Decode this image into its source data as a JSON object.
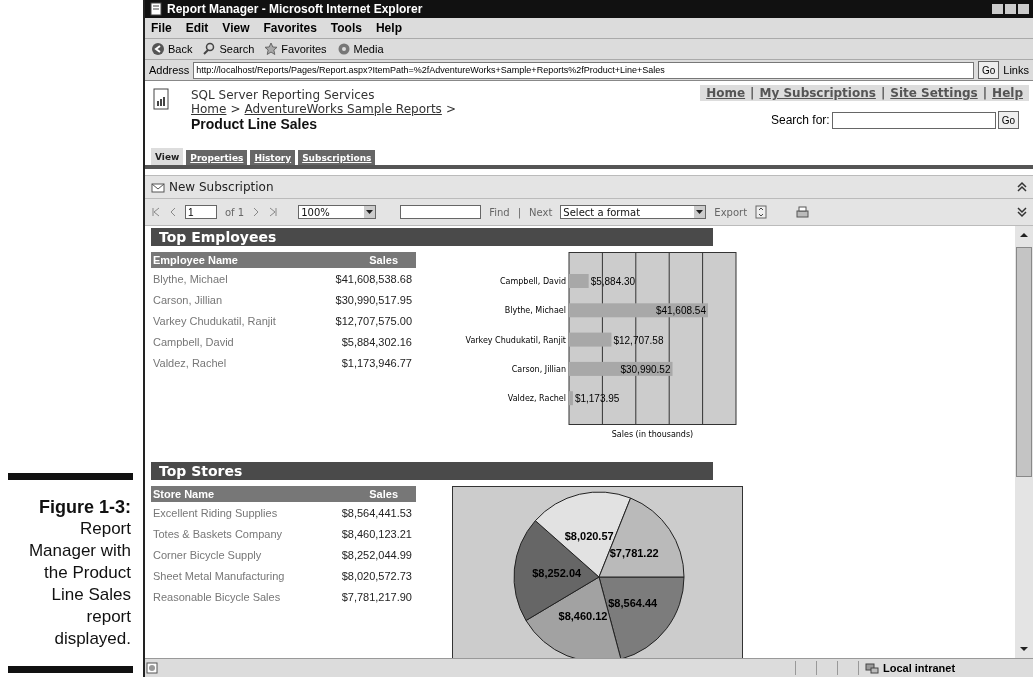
{
  "caption": {
    "label": "Figure 1-3:",
    "text": "Report Manager with the Product Line Sales report displayed."
  },
  "window": {
    "title": "Report Manager - Microsoft Internet Explorer"
  },
  "menu_bar": [
    "File",
    "Edit",
    "View",
    "Favorites",
    "Tools",
    "Help"
  ],
  "toolbar": [
    {
      "label": "Back",
      "kind": "back"
    },
    {
      "label": "Search",
      "kind": "search"
    },
    {
      "label": "Favorites",
      "kind": "favorites"
    },
    {
      "label": "Media",
      "kind": "media"
    }
  ],
  "address": {
    "label": "Address",
    "url": "http://localhost/Reports/Pages/Report.aspx?ItemPath=%2fAdventureWorks+Sample+Reports%2fProduct+Line+Sales",
    "go": "Go",
    "links": "Links"
  },
  "header": {
    "product": "SQL Server Reporting Services",
    "breadcrumb": [
      {
        "label": "Home",
        "separator": ">"
      },
      {
        "label": "AdventureWorks Sample Reports",
        "separator": ">"
      }
    ],
    "title": "Product Line Sales",
    "top_links": [
      {
        "label": "Home",
        "separator": "|"
      },
      {
        "label": "My Subscriptions",
        "separator": "|"
      },
      {
        "label": "Site Settings",
        "separator": "|"
      },
      {
        "label": "Help"
      }
    ],
    "search": {
      "label": "Search for:",
      "button": "Go"
    }
  },
  "tabs": [
    {
      "label": "View",
      "selected": true
    },
    {
      "label": "Properties",
      "selected": false
    },
    {
      "label": "History",
      "selected": false
    },
    {
      "label": "Subscriptions",
      "selected": false
    }
  ],
  "action": "New Subscription",
  "report_toolbar": {
    "page": "1",
    "of": "of 1",
    "zoom": "100%",
    "find": "Find",
    "separator": "|",
    "next": "Next",
    "format": "Select a format",
    "export": "Export"
  },
  "sections": [
    {
      "title": "Top Employees",
      "columns": [
        "Employee Name",
        "Sales"
      ],
      "rows": [
        [
          "Blythe, Michael",
          "$41,608,538.68"
        ],
        [
          "Carson, Jillian",
          "$30,990,517.95"
        ],
        [
          "Varkey Chudukatil, Ranjit",
          "$12,707,575.00"
        ],
        [
          "Campbell, David",
          "$5,884,302.16"
        ],
        [
          "Valdez, Rachel",
          "$1,173,946.77"
        ]
      ],
      "chart_data": {
        "type": "bar",
        "orientation": "horizontal",
        "xlabel": "Sales (in thousands)",
        "categories": [
          "Campbell, David",
          "Blythe, Michael",
          "Varkey Chudukatil, Ranjit",
          "Carson, Jillian",
          "Valdez, Rachel"
        ],
        "values": [
          5884.3,
          41608.54,
          12707.58,
          30990.52,
          1173.95
        ],
        "value_labels": [
          "$5,884.30",
          "$41,608.54",
          "$12,707.58",
          "$30,990.52",
          "$1,173.95"
        ],
        "xlim": [
          0,
          50000
        ]
      }
    },
    {
      "title": "Top Stores",
      "columns": [
        "Store Name",
        "Sales"
      ],
      "rows": [
        [
          "Excellent Riding Supplies",
          "$8,564,441.53"
        ],
        [
          "Totes & Baskets Company",
          "$8,460,123.21"
        ],
        [
          "Corner Bicycle Supply",
          "$8,252,044.99"
        ],
        [
          "Sheet Metal Manufacturing",
          "$8,020,572.73"
        ],
        [
          "Reasonable Bicycle Sales",
          "$7,781,217.90"
        ]
      ],
      "chart_data": {
        "type": "pie",
        "values": [
          8564.44,
          8460.12,
          8252.04,
          8020.57,
          7781.22
        ],
        "value_labels": [
          "$8,564.44",
          "$8,460.12",
          "$8,252.04",
          "$8,020.57",
          "$7,781.22"
        ]
      }
    }
  ],
  "status_bar": {
    "zone": "Local intranet"
  }
}
